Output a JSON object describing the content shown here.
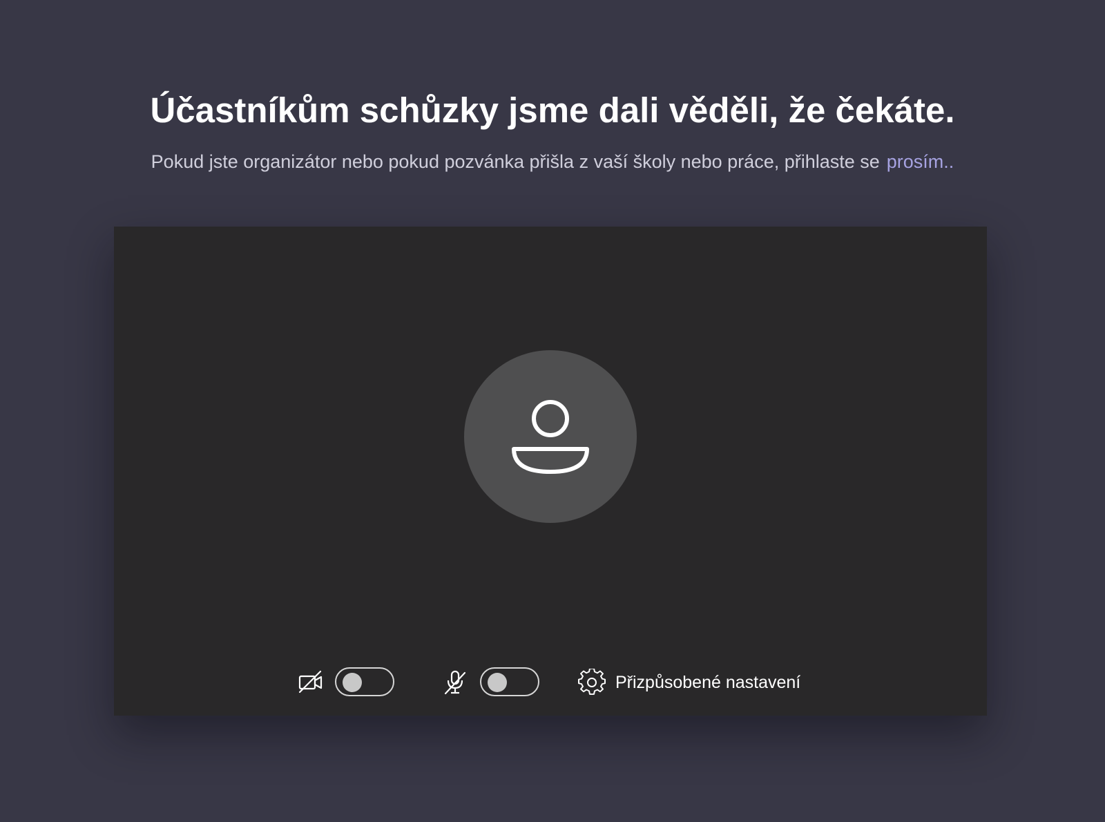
{
  "lobby": {
    "heading": "Účastníkům schůzky jsme dali věděli, že čekáte.",
    "subtext": "Pokud jste organizátor nebo pokud pozvánka přišla z vaší školy nebo práce, přihlaste se",
    "signin_link": "prosím..",
    "link_color": "#a7a3e2"
  },
  "preview": {
    "avatar_icon": "person-icon"
  },
  "controls": {
    "camera": {
      "icon": "camera-off-icon",
      "state": "off"
    },
    "microphone": {
      "icon": "mic-off-icon",
      "state": "off"
    },
    "settings": {
      "icon": "gear-icon",
      "label": "Přizpůsobené nastavení"
    }
  },
  "colors": {
    "background": "#383746",
    "preview_background": "#292829",
    "avatar_background": "#4f4f50"
  }
}
